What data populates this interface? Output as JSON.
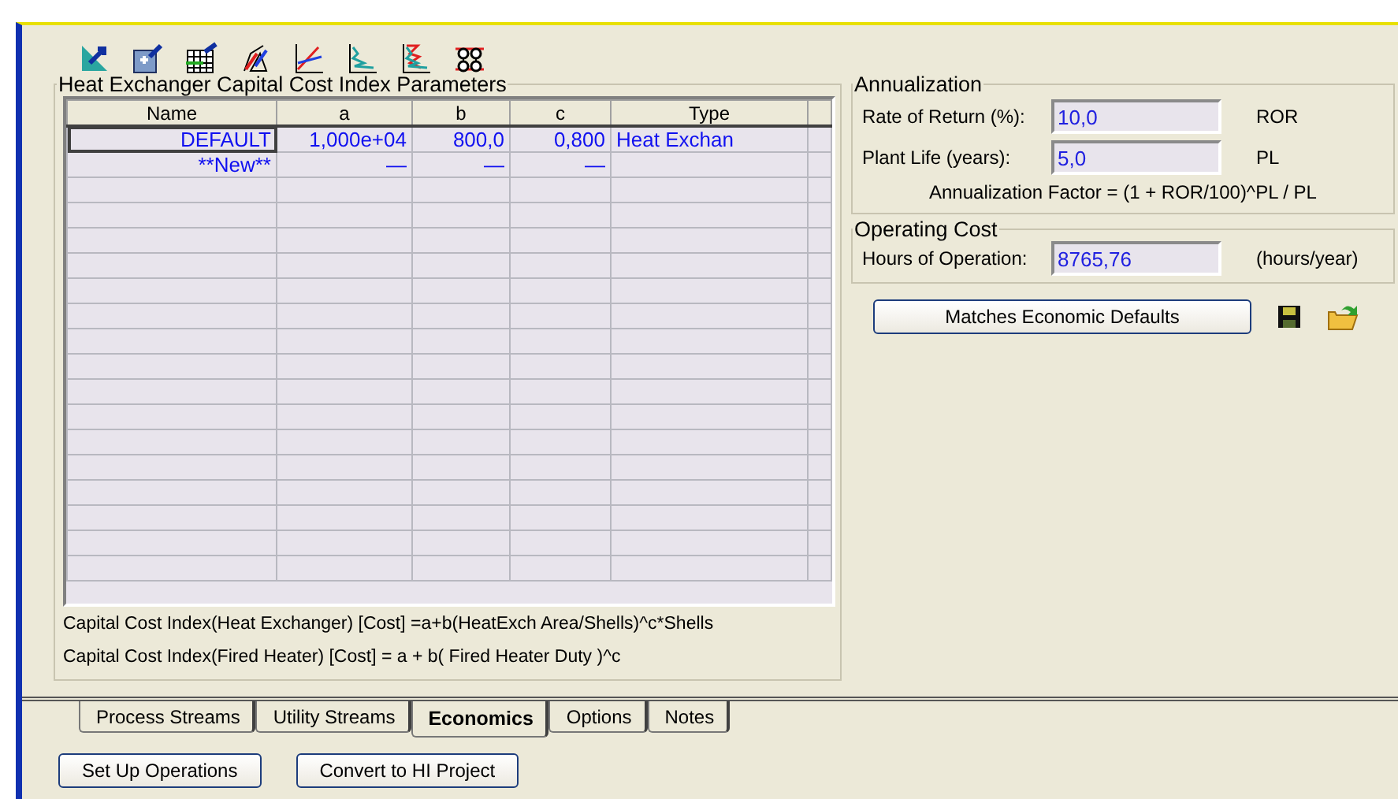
{
  "toolbar": {
    "buttons": [
      {
        "kind": "pointer"
      },
      {
        "kind": "text"
      },
      {
        "kind": "table"
      },
      {
        "kind": "arrows"
      },
      {
        "kind": "lines"
      },
      {
        "kind": "curve"
      },
      {
        "kind": "curve2"
      },
      {
        "kind": "network"
      }
    ]
  },
  "cost_index": {
    "title": "Heat Exchanger Capital Cost Index Parameters",
    "table": {
      "columns": [
        "Name",
        "a",
        "b",
        "c",
        "Type"
      ],
      "rows": [
        {
          "cells": [
            "DEFAULT",
            "1,000e+04",
            "800,0",
            "0,800",
            "Heat Exchan"
          ]
        },
        {
          "cells": [
            "**New**",
            "—",
            "—",
            "—",
            ""
          ]
        }
      ]
    },
    "formulas": [
      "Capital Cost Index(Heat Exchanger) [Cost] =a+b(HeatExch Area/Shells)^c*Shells",
      "Capital Cost Index(Fired Heater) [Cost] = a + b( Fired Heater Duty )^c"
    ]
  },
  "annualization": {
    "title": "Annualization",
    "fields": [
      {
        "label": "Rate of Return (%):",
        "value": "10,0",
        "unit": "ROR"
      },
      {
        "label": "Plant Life (years):",
        "value": "5,0",
        "unit": "PL"
      }
    ],
    "formula": "Annualization Factor = (1 + ROR/100)^PL / PL"
  },
  "operating_cost": {
    "title": "Operating Cost",
    "label": "Hours of Operation:",
    "value": "8765,76",
    "unit": "(hours/year)"
  },
  "defaults_button": "Matches Economic Defaults",
  "tabs": [
    {
      "label": "Process Streams",
      "selected": false
    },
    {
      "label": "Utility Streams",
      "selected": false
    },
    {
      "label": "Economics",
      "selected": true
    },
    {
      "label": "Options",
      "selected": false
    },
    {
      "label": "Notes",
      "selected": false
    }
  ],
  "buttons": [
    "Set Up Operations",
    "Convert to HI Project"
  ]
}
